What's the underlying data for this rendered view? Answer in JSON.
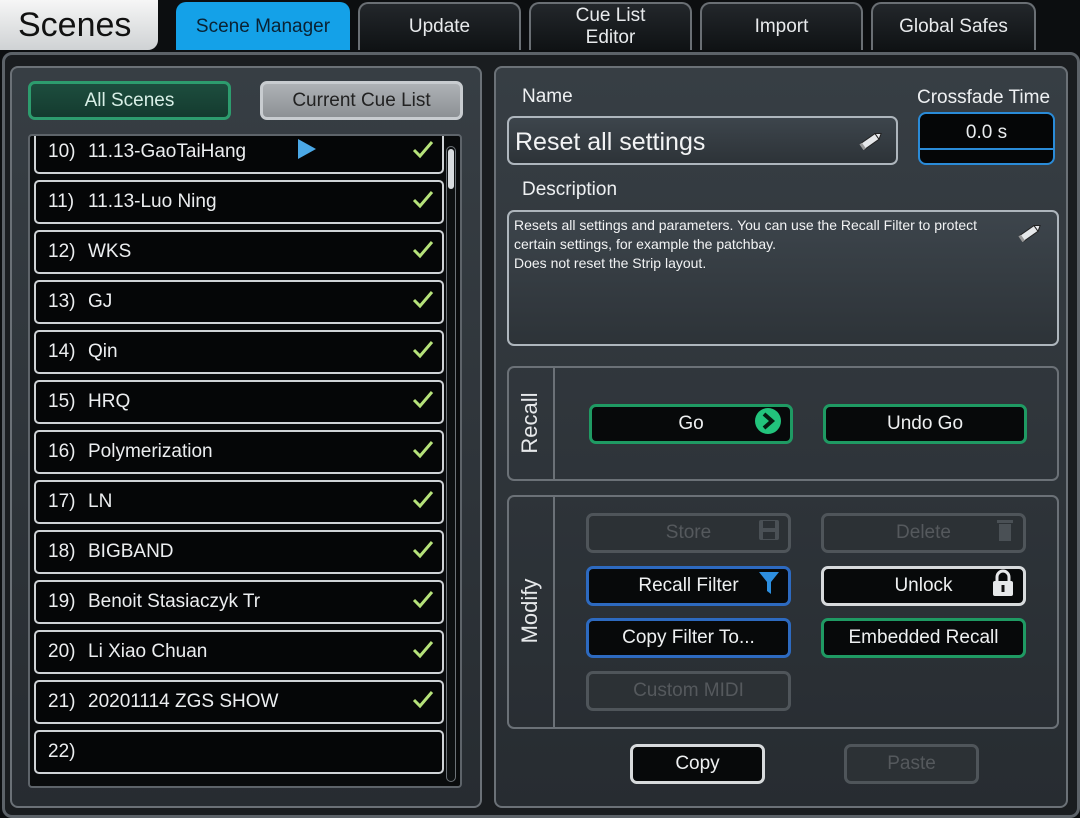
{
  "app": {
    "title": "Scenes"
  },
  "tabs": [
    {
      "label": "Scene Manager",
      "active": true
    },
    {
      "label": "Update",
      "active": false
    },
    {
      "label": "Cue List Editor",
      "active": false
    },
    {
      "label": "Import",
      "active": false
    },
    {
      "label": "Global Safes",
      "active": false
    }
  ],
  "list_filters": {
    "all_scenes": "All Scenes",
    "current_cue_list": "Current Cue List"
  },
  "scenes": [
    {
      "num": "10)",
      "name": "11.13-GaoTaiHang",
      "checked": true,
      "current": true
    },
    {
      "num": "11)",
      "name": "11.13-Luo Ning",
      "checked": true
    },
    {
      "num": "12)",
      "name": "WKS",
      "checked": true
    },
    {
      "num": "13)",
      "name": "GJ",
      "checked": true
    },
    {
      "num": "14)",
      "name": "Qin",
      "checked": true
    },
    {
      "num": "15)",
      "name": "HRQ",
      "checked": true
    },
    {
      "num": "16)",
      "name": "Polymerization",
      "checked": true
    },
    {
      "num": "17)",
      "name": "LN",
      "checked": true
    },
    {
      "num": "18)",
      "name": "BIGBAND",
      "checked": true
    },
    {
      "num": "19)",
      "name": "Benoit Stasiaczyk Tr",
      "checked": true
    },
    {
      "num": "20)",
      "name": "Li Xiao Chuan",
      "checked": true
    },
    {
      "num": "21)",
      "name": "20201114 ZGS SHOW",
      "checked": true
    },
    {
      "num": "22)",
      "name": "",
      "checked": false
    }
  ],
  "details": {
    "name_label": "Name",
    "name_value": "Reset all settings",
    "crossfade_label": "Crossfade Time",
    "crossfade_value": "0.0 s",
    "description_label": "Description",
    "description_lines": [
      "Resets all settings and parameters. You can use the Recall Filter to protect",
      "certain settings, for example the patchbay.",
      "Does not reset the Strip layout."
    ]
  },
  "recall": {
    "section_label": "Recall",
    "go": "Go",
    "undo_go": "Undo Go"
  },
  "modify": {
    "section_label": "Modify",
    "store": "Store",
    "delete": "Delete",
    "recall_filter": "Recall Filter",
    "unlock": "Unlock",
    "copy_filter_to": "Copy Filter To...",
    "embedded_recall": "Embedded Recall",
    "custom_midi": "Custom MIDI"
  },
  "clipboard": {
    "copy": "Copy",
    "paste": "Paste"
  },
  "colors": {
    "active_tab": "#14a1e8",
    "green_accent": "#1f9a63",
    "blue_accent": "#2d6ac0",
    "check_green": "#b6e27a"
  }
}
